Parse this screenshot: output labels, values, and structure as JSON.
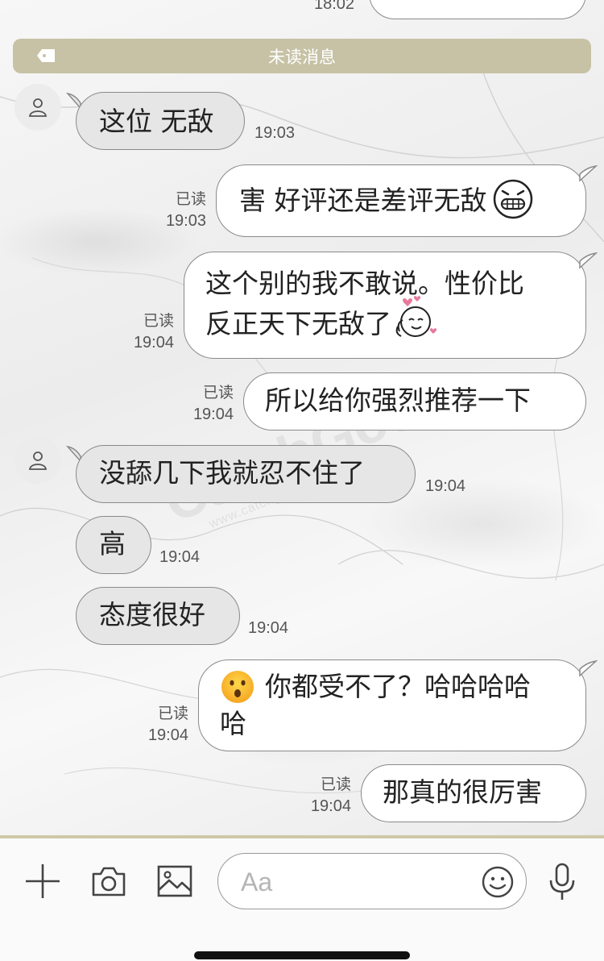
{
  "top_partial": {
    "time": "18:02"
  },
  "unread_banner": {
    "label": "未读消息"
  },
  "messages": [
    {
      "side": "in",
      "text": "这位 无敌",
      "time": "19:03"
    },
    {
      "side": "out",
      "text": "害 好评还是差评无敌",
      "emoji": "grimacing-face-emoji",
      "status": "已读",
      "time": "19:03"
    },
    {
      "side": "out",
      "line1": "这个别的我不敢说。性价比",
      "line2": "反正天下无敌了",
      "emoji": "love-sticker-emoji",
      "status": "已读",
      "time": "19:04"
    },
    {
      "side": "out",
      "text": "所以给你强烈推荐一下",
      "status": "已读",
      "time": "19:04"
    },
    {
      "side": "in",
      "text": "没舔几下我就忍不住了",
      "time": "19:04"
    },
    {
      "side": "in",
      "text": "高",
      "time": "19:04"
    },
    {
      "side": "in",
      "text": "态度很好",
      "time": "19:04"
    },
    {
      "side": "out",
      "line1": "你都受不了？哈哈哈哈",
      "line2": "哈",
      "emoji": "hushed-face-emoji",
      "status": "已读",
      "time": "19:04"
    },
    {
      "side": "out",
      "text": "那真的很厉害",
      "status": "已读",
      "time": "19:04"
    }
  ],
  "watermark": {
    "brand": "CatchGod",
    "url": "www.catchgod.com"
  },
  "composer": {
    "placeholder": "Aa",
    "icons": [
      "plus-icon",
      "camera-icon",
      "image-icon",
      "smiley-icon",
      "microphone-icon"
    ]
  },
  "colors": {
    "banner": "#c7c2a5",
    "incoming_bubble": "#e6e6e6",
    "outgoing_bubble": "#ffffff",
    "bubble_border": "#8a8a8a"
  }
}
